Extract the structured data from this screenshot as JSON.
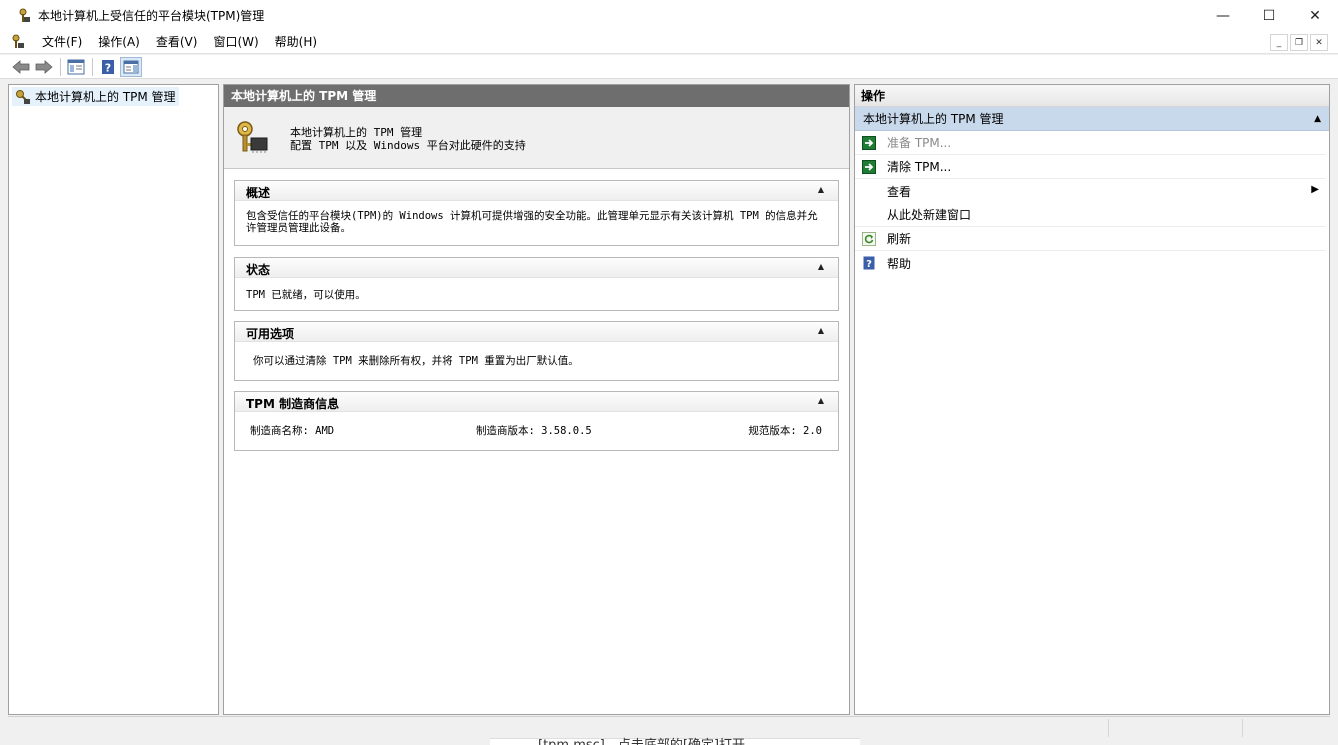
{
  "window": {
    "title": "本地计算机上受信任的平台模块(TPM)管理",
    "minimize": "—",
    "maximize": "☐",
    "close": "✕"
  },
  "menu": {
    "items": [
      "文件(F)",
      "操作(A)",
      "查看(V)",
      "窗口(W)",
      "帮助(H)"
    ],
    "mdi_minimize": "_",
    "mdi_restore": "❐",
    "mdi_close": "✕"
  },
  "tree": {
    "root_label": "本地计算机上的 TPM 管理"
  },
  "center": {
    "header": "本地计算机上的 TPM 管理",
    "intro_title": "本地计算机上的 TPM 管理",
    "intro_desc": "配置 TPM 以及 Windows 平台对此硬件的支持",
    "sections": {
      "overview": {
        "title": "概述",
        "text": "包含受信任的平台模块(TPM)的 Windows 计算机可提供增强的安全功能。此管理单元显示有关该计算机 TPM 的信息并允许管理员管理此设备。"
      },
      "status": {
        "title": "状态",
        "text": "TPM 已就绪，可以使用。"
      },
      "options": {
        "title": "可用选项",
        "text": "你可以通过清除 TPM 来删除所有权，并将 TPM 重置为出厂默认值。"
      },
      "manufacturer": {
        "title": "TPM 制造商信息",
        "name": "制造商名称: AMD",
        "version": "制造商版本: 3.58.0.5",
        "spec": "规范版本: 2.0"
      }
    },
    "toggle_glyph": "▲"
  },
  "actions": {
    "header": "操作",
    "group": "本地计算机上的 TPM 管理",
    "group_toggle": "▲",
    "items": {
      "prepare": "准备 TPM...",
      "clear": "清除 TPM...",
      "view": "查看",
      "new_window": "从此处新建窗口",
      "refresh": "刷新",
      "help": "帮助"
    },
    "submenu_arrow": "▶"
  },
  "colors": {
    "selection": "#e5f1fb",
    "center_header": "#6e6e6e",
    "actions_group": "#c9d9ec",
    "green_action": "#1e7d32"
  },
  "background": {
    "partial_text": "[tpm.msc]，点击底部的[确定]打开"
  }
}
